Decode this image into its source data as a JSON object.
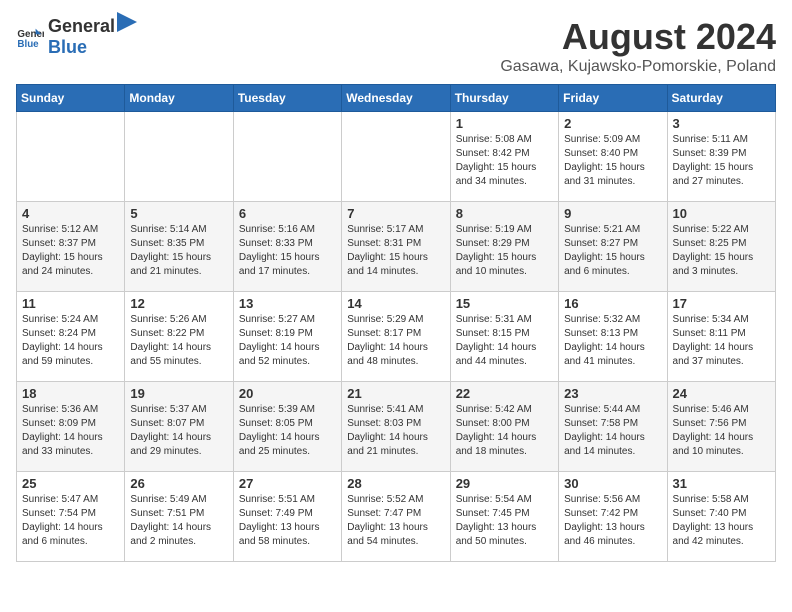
{
  "header": {
    "logo_general": "General",
    "logo_blue": "Blue",
    "month_year": "August 2024",
    "location": "Gasawa, Kujawsko-Pomorskie, Poland"
  },
  "days_of_week": [
    "Sunday",
    "Monday",
    "Tuesday",
    "Wednesday",
    "Thursday",
    "Friday",
    "Saturday"
  ],
  "weeks": [
    [
      {
        "day": "",
        "info": ""
      },
      {
        "day": "",
        "info": ""
      },
      {
        "day": "",
        "info": ""
      },
      {
        "day": "",
        "info": ""
      },
      {
        "day": "1",
        "info": "Sunrise: 5:08 AM\nSunset: 8:42 PM\nDaylight: 15 hours\nand 34 minutes."
      },
      {
        "day": "2",
        "info": "Sunrise: 5:09 AM\nSunset: 8:40 PM\nDaylight: 15 hours\nand 31 minutes."
      },
      {
        "day": "3",
        "info": "Sunrise: 5:11 AM\nSunset: 8:39 PM\nDaylight: 15 hours\nand 27 minutes."
      }
    ],
    [
      {
        "day": "4",
        "info": "Sunrise: 5:12 AM\nSunset: 8:37 PM\nDaylight: 15 hours\nand 24 minutes."
      },
      {
        "day": "5",
        "info": "Sunrise: 5:14 AM\nSunset: 8:35 PM\nDaylight: 15 hours\nand 21 minutes."
      },
      {
        "day": "6",
        "info": "Sunrise: 5:16 AM\nSunset: 8:33 PM\nDaylight: 15 hours\nand 17 minutes."
      },
      {
        "day": "7",
        "info": "Sunrise: 5:17 AM\nSunset: 8:31 PM\nDaylight: 15 hours\nand 14 minutes."
      },
      {
        "day": "8",
        "info": "Sunrise: 5:19 AM\nSunset: 8:29 PM\nDaylight: 15 hours\nand 10 minutes."
      },
      {
        "day": "9",
        "info": "Sunrise: 5:21 AM\nSunset: 8:27 PM\nDaylight: 15 hours\nand 6 minutes."
      },
      {
        "day": "10",
        "info": "Sunrise: 5:22 AM\nSunset: 8:25 PM\nDaylight: 15 hours\nand 3 minutes."
      }
    ],
    [
      {
        "day": "11",
        "info": "Sunrise: 5:24 AM\nSunset: 8:24 PM\nDaylight: 14 hours\nand 59 minutes."
      },
      {
        "day": "12",
        "info": "Sunrise: 5:26 AM\nSunset: 8:22 PM\nDaylight: 14 hours\nand 55 minutes."
      },
      {
        "day": "13",
        "info": "Sunrise: 5:27 AM\nSunset: 8:19 PM\nDaylight: 14 hours\nand 52 minutes."
      },
      {
        "day": "14",
        "info": "Sunrise: 5:29 AM\nSunset: 8:17 PM\nDaylight: 14 hours\nand 48 minutes."
      },
      {
        "day": "15",
        "info": "Sunrise: 5:31 AM\nSunset: 8:15 PM\nDaylight: 14 hours\nand 44 minutes."
      },
      {
        "day": "16",
        "info": "Sunrise: 5:32 AM\nSunset: 8:13 PM\nDaylight: 14 hours\nand 41 minutes."
      },
      {
        "day": "17",
        "info": "Sunrise: 5:34 AM\nSunset: 8:11 PM\nDaylight: 14 hours\nand 37 minutes."
      }
    ],
    [
      {
        "day": "18",
        "info": "Sunrise: 5:36 AM\nSunset: 8:09 PM\nDaylight: 14 hours\nand 33 minutes."
      },
      {
        "day": "19",
        "info": "Sunrise: 5:37 AM\nSunset: 8:07 PM\nDaylight: 14 hours\nand 29 minutes."
      },
      {
        "day": "20",
        "info": "Sunrise: 5:39 AM\nSunset: 8:05 PM\nDaylight: 14 hours\nand 25 minutes."
      },
      {
        "day": "21",
        "info": "Sunrise: 5:41 AM\nSunset: 8:03 PM\nDaylight: 14 hours\nand 21 minutes."
      },
      {
        "day": "22",
        "info": "Sunrise: 5:42 AM\nSunset: 8:00 PM\nDaylight: 14 hours\nand 18 minutes."
      },
      {
        "day": "23",
        "info": "Sunrise: 5:44 AM\nSunset: 7:58 PM\nDaylight: 14 hours\nand 14 minutes."
      },
      {
        "day": "24",
        "info": "Sunrise: 5:46 AM\nSunset: 7:56 PM\nDaylight: 14 hours\nand 10 minutes."
      }
    ],
    [
      {
        "day": "25",
        "info": "Sunrise: 5:47 AM\nSunset: 7:54 PM\nDaylight: 14 hours\nand 6 minutes."
      },
      {
        "day": "26",
        "info": "Sunrise: 5:49 AM\nSunset: 7:51 PM\nDaylight: 14 hours\nand 2 minutes."
      },
      {
        "day": "27",
        "info": "Sunrise: 5:51 AM\nSunset: 7:49 PM\nDaylight: 13 hours\nand 58 minutes."
      },
      {
        "day": "28",
        "info": "Sunrise: 5:52 AM\nSunset: 7:47 PM\nDaylight: 13 hours\nand 54 minutes."
      },
      {
        "day": "29",
        "info": "Sunrise: 5:54 AM\nSunset: 7:45 PM\nDaylight: 13 hours\nand 50 minutes."
      },
      {
        "day": "30",
        "info": "Sunrise: 5:56 AM\nSunset: 7:42 PM\nDaylight: 13 hours\nand 46 minutes."
      },
      {
        "day": "31",
        "info": "Sunrise: 5:58 AM\nSunset: 7:40 PM\nDaylight: 13 hours\nand 42 minutes."
      }
    ]
  ]
}
